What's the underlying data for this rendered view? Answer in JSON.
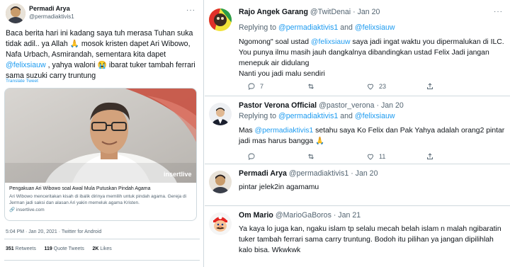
{
  "left": {
    "name": "Permadi Arya",
    "handle": "@permadiaktivis1",
    "text_part1": "Baca berita hari ini kadang saya tuh merasa Tuhan suka tidak adil.. ya Allah ",
    "emoji1": "🙏",
    "text_part2": "  mosok kristen dapet Ari Wibowo, Nafa Urbach, Asmirandah, sementara kita dapet ",
    "mention": "@felixsiauw",
    "text_part3": " , yahya waloni ",
    "emoji2": "😭",
    "text_part4": " ibarat tuker tambah ferrari sama suzuki carry truntung",
    "translate": "Translate Tweet",
    "card": {
      "brand": "insertlive",
      "title": "Pengakuan Ari Wibowo soal Awal Mula Putuskan Pindah Agama",
      "description": "Ari Wibowo menceritakan kisah di ibalik dirinya memilih untuk pindah agama. Gereja di Jerman jadi saksi dan alasan Ari yakin memeluk agama Kristen.",
      "domain": "insertlive.com"
    },
    "meta": "5:04 PM · Jan 20, 2021 · Twitter for Android",
    "stats": {
      "retweets_count": "351",
      "retweets_label": "Retweets",
      "quotes_count": "119",
      "quotes_label": "Quote Tweets",
      "likes_count": "2K",
      "likes_label": "Likes"
    }
  },
  "replies": [
    {
      "name": "Rajo Angek Garang",
      "handle": "@TwitDenai",
      "date": "· Jan 20",
      "replying_label": "Replying to ",
      "replying_to": "@permadiaktivis1",
      "and_label": " and ",
      "replying_to2": "@felixsiauw",
      "body_part1": "Ngomong\" soal ustad ",
      "body_mention": "@felixsiauw",
      "body_part2": " saya jadi ingat waktu you dipermalukan di ILC. You punya ilmu masih jauh dangkalnya dibandingkan ustad Felix Jadi jangan menepuk air didulang",
      "body_extra": "Nanti you jadi malu sendiri",
      "reply_count": "7",
      "retweet_count": "",
      "like_count": "23"
    },
    {
      "name": "Pastor Verona Official",
      "handle": "@pastor_verona",
      "date": "· Jan 20",
      "replying_label": "Replying to ",
      "replying_to": "@permadiaktivis1",
      "and_label": " and ",
      "replying_to2": "@felixsiauw",
      "body_part1": "Mas ",
      "body_mention": "@permadiaktivis1",
      "body_part2": " setahu saya Ko Felix dan Pak Yahya adalah orang2 pintar jadi mas harus bangga ",
      "body_emoji": "🙏",
      "reply_count": "",
      "retweet_count": "",
      "like_count": "11"
    },
    {
      "name": "Permadi Arya",
      "handle": "@permadiaktivis1",
      "date": "· Jan 20",
      "body_part1": "pintar jelek2in agamamu",
      "reply_count": "",
      "retweet_count": "",
      "like_count": ""
    },
    {
      "name": "Om Mario",
      "handle": "@MarioGaBoros",
      "date": "· Jan 21",
      "body_part1": "Ya kaya lo juga kan, ngaku islam tp selalu mecah belah islam n malah ngibaratin tuker tambah ferrari sama carry truntung. Bodoh itu pilihan ya jangan dipilihlah kalo bisa. Wkwkwk"
    }
  ],
  "colors": {
    "accent": "#1d9bf0",
    "secondary_text": "#536471",
    "border": "#cfd9de"
  },
  "icons": [
    "avatar",
    "more-icon",
    "reply-icon",
    "retweet-icon",
    "like-icon",
    "share-icon"
  ]
}
